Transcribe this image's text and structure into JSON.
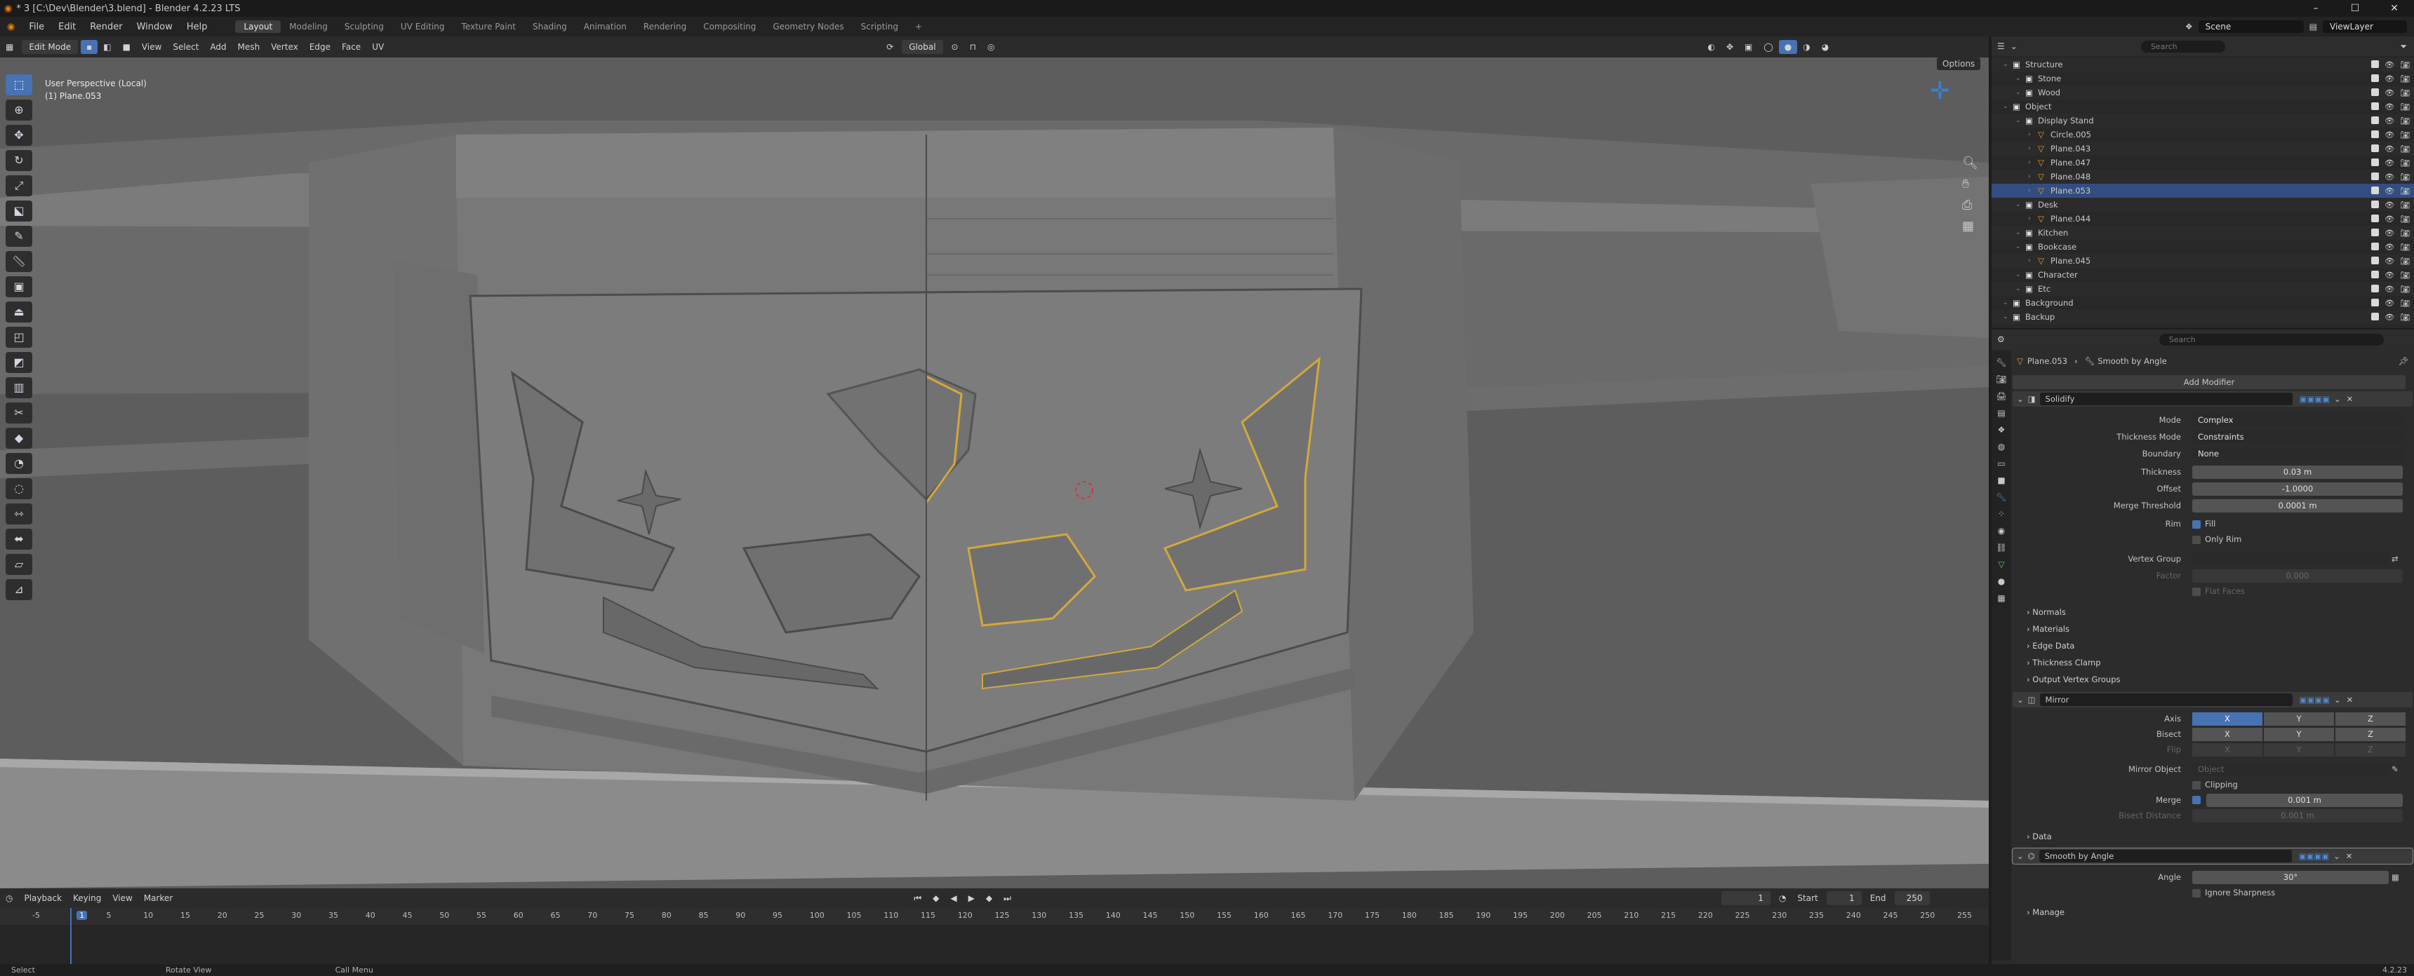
{
  "title": "* 3 [C:\\Dev\\Blender\\3.blend] - Blender 4.2.23 LTS",
  "menu": [
    "File",
    "Edit",
    "Render",
    "Window",
    "Help"
  ],
  "workspaces": [
    "Layout",
    "Modeling",
    "Sculpting",
    "UV Editing",
    "Texture Paint",
    "Shading",
    "Animation",
    "Rendering",
    "Compositing",
    "Geometry Nodes",
    "Scripting"
  ],
  "scene": "Scene",
  "view_layer": "ViewLayer",
  "viewport": {
    "mode": "Edit Mode",
    "menus": [
      "View",
      "Select",
      "Add",
      "Mesh",
      "Vertex",
      "Edge",
      "Face",
      "UV"
    ],
    "transform": "Global",
    "options": "Options",
    "info_line1": "User Perspective (Local)",
    "info_line2": "(1) Plane.053"
  },
  "timeline": {
    "menus": [
      "Playback",
      "Keying",
      "View",
      "Marker"
    ],
    "current_frame": "1",
    "start_label": "Start",
    "start": "1",
    "end_label": "End",
    "end": "250",
    "ticks": [
      "-5",
      "1",
      "5",
      "10",
      "15",
      "20",
      "25",
      "30",
      "35",
      "40",
      "45",
      "50",
      "55",
      "60",
      "65",
      "70",
      "75",
      "80",
      "85",
      "90",
      "95",
      "100",
      "105",
      "110",
      "115",
      "120",
      "125",
      "130",
      "135",
      "140",
      "145",
      "150",
      "155",
      "160",
      "165",
      "170",
      "175",
      "180",
      "185",
      "190",
      "195",
      "200",
      "205",
      "210",
      "215",
      "220",
      "225",
      "230",
      "235",
      "240",
      "245",
      "250",
      "255"
    ]
  },
  "status": {
    "select": "Select",
    "rotate": "Rotate View",
    "call_menu": "Call Menu",
    "version": "4.2.23"
  },
  "outliner": {
    "search": "Search",
    "rows": [
      {
        "label": "Structure",
        "indent": 1
      },
      {
        "label": "Stone",
        "indent": 2
      },
      {
        "label": "Wood",
        "indent": 2
      },
      {
        "label": "Object",
        "indent": 1
      },
      {
        "label": "Display Stand",
        "indent": 2
      },
      {
        "label": "Circle.005",
        "indent": 3
      },
      {
        "label": "Plane.043",
        "indent": 3
      },
      {
        "label": "Plane.047",
        "indent": 3
      },
      {
        "label": "Plane.048",
        "indent": 3
      },
      {
        "label": "Plane.053",
        "indent": 3
      },
      {
        "label": "Desk",
        "indent": 2
      },
      {
        "label": "Plane.044",
        "indent": 3
      },
      {
        "label": "Kitchen",
        "indent": 2
      },
      {
        "label": "Bookcase",
        "indent": 2
      },
      {
        "label": "Plane.045",
        "indent": 3
      },
      {
        "label": "Character",
        "indent": 2
      },
      {
        "label": "Etc",
        "indent": 2
      },
      {
        "label": "Background",
        "indent": 1
      },
      {
        "label": "Backup",
        "indent": 1
      }
    ]
  },
  "props": {
    "search": "Search",
    "object": "Plane.053",
    "modifier_ctx": "Smooth by Angle",
    "add_modifier": "Add Modifier",
    "solidify": {
      "name": "Solidify",
      "mode_label": "Mode",
      "mode": "Complex",
      "thickness_mode_label": "Thickness Mode",
      "thickness_mode": "Constraints",
      "boundary_label": "Boundary",
      "boundary": "None",
      "thickness_label": "Thickness",
      "thickness": "0.03 m",
      "offset_label": "Offset",
      "offset": "-1.0000",
      "merge_label": "Merge Threshold",
      "merge": "0.0001 m",
      "rim_label": "Rim",
      "fill": "Fill",
      "only_rim": "Only Rim",
      "vgroup_label": "Vertex Group",
      "factor_label": "Factor",
      "factor": "0.000",
      "flat_faces": "Flat Faces",
      "sections": [
        "Normals",
        "Materials",
        "Edge Data",
        "Thickness Clamp",
        "Output Vertex Groups"
      ]
    },
    "mirror": {
      "name": "Mirror",
      "axis_label": "Axis",
      "bisect_label": "Bisect",
      "flip_label": "Flip",
      "axes": [
        "X",
        "Y",
        "Z"
      ],
      "mirror_obj_label": "Mirror Object",
      "mirror_obj_placeholder": "Object",
      "clipping": "Clipping",
      "merge_label": "Merge",
      "merge": "0.001 m",
      "bisect_dist_label": "Bisect Distance",
      "bisect_dist": "0.001 m",
      "data": "Data"
    },
    "smooth": {
      "name": "Smooth by Angle",
      "angle_label": "Angle",
      "angle": "30°",
      "ignore": "Ignore Sharpness",
      "manage": "Manage"
    }
  }
}
